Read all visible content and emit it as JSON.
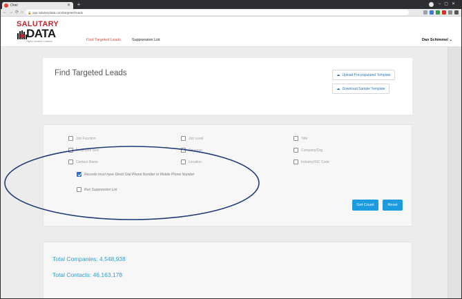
{
  "browser": {
    "tab_title": "Oriel",
    "url": "app.salutarydata.com/targeted-leads",
    "colors": {
      "chrome_dark": "#2d2e31",
      "toolbar": "#e9e9e9"
    }
  },
  "header": {
    "logo_top": "SALUTARY",
    "logo_bottom": "DATA",
    "logo_tagline": "Highly Curated Contacts",
    "nav": [
      {
        "label": "Find Targeted Leads",
        "active": true
      },
      {
        "label": "Suppression List",
        "active": false
      }
    ],
    "user_name": "Dan Schimmel",
    "colors": {
      "brand_red": "#c1272d",
      "nav_active": "#d64a35"
    }
  },
  "main": {
    "title": "Find Targeted Leads",
    "upload_label": "Upload Pre-populated Template",
    "download_label": "Download Sample Template",
    "link_color": "#2b75b8"
  },
  "filters": {
    "col1": [
      "Job Function",
      "Employee Size",
      "Contact Name"
    ],
    "col2": [
      "Job Level",
      "Revenue",
      "Location"
    ],
    "col3": [
      "Title",
      "Company/Org",
      "Industry/SIC Code"
    ],
    "require_phone_label": "Records must have Direct Dial Phone Number or Mobile Phone Number",
    "require_phone_checked": true,
    "run_suppression_label": "Run Suppression List",
    "run_suppression_checked": false,
    "get_count_label": "Get Count",
    "reset_label": "Reset",
    "button_color": "#1c9be0"
  },
  "totals": {
    "companies": "Total Companies: 4,548,938",
    "contacts": "Total Contacts: 46,163,178",
    "color": "#2b9fc9"
  },
  "annotation": {
    "color": "#1f3a78"
  }
}
